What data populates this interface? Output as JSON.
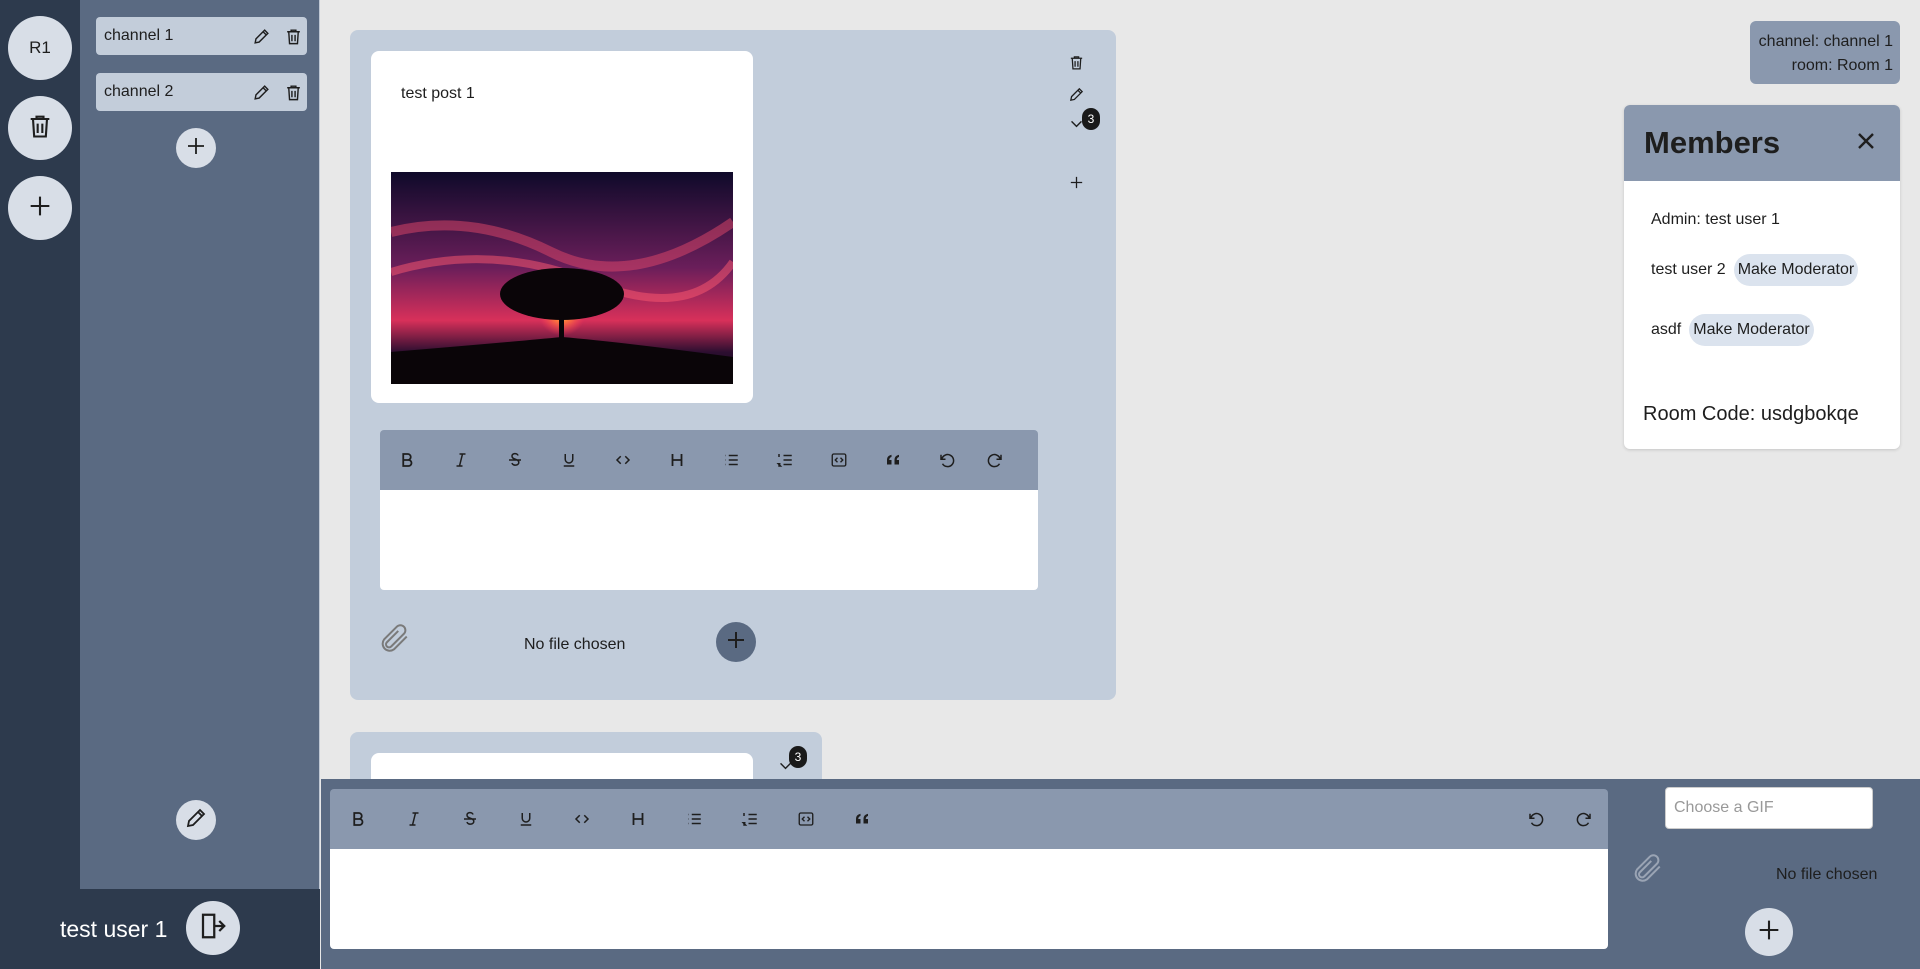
{
  "rooms": {
    "current_room_label": "R1",
    "delete_icon": "trash-icon",
    "add_icon": "plus-icon"
  },
  "channels": {
    "items": [
      {
        "label": "channel 1"
      },
      {
        "label": "channel 2"
      }
    ],
    "add_icon": "plus-icon",
    "edit_icon": "pencil-icon"
  },
  "user": {
    "name": "test user 1",
    "logout_icon": "logout-icon"
  },
  "posts": [
    {
      "text": "test post 1",
      "reply_count": "3",
      "has_image": true,
      "file_status": "No file chosen"
    },
    {
      "text": "",
      "reply_count": "3"
    }
  ],
  "editor_toolbar": {
    "buttons": [
      "bold",
      "italic",
      "strikethrough",
      "underline",
      "code",
      "heading",
      "bullet-list",
      "ordered-list",
      "code-block",
      "blockquote",
      "undo",
      "redo"
    ]
  },
  "channel_info": {
    "channel_line": "channel: channel 1",
    "room_line": "room: Room 1"
  },
  "members": {
    "title": "Members",
    "admin_line": "Admin: test user 1",
    "list": [
      {
        "name": "test user 2",
        "action": "Make Moderator"
      },
      {
        "name": "asdf",
        "action": "Make Moderator"
      }
    ],
    "room_code_line": "Room Code: usdgbokqe"
  },
  "composer": {
    "gif_placeholder": "Choose a GIF",
    "file_status": "No file chosen"
  },
  "colors": {
    "dark_navy": "#2d3a4d",
    "slate": "#5a6a82",
    "card_bg": "#c2cddb",
    "toolbar_bg": "#8a98ae"
  }
}
